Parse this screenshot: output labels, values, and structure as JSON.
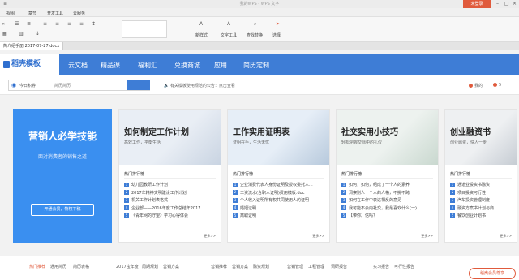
{
  "window": {
    "title": "我的WPS - WPS 文字",
    "login": "未登录"
  },
  "menu": [
    "视图",
    "章节",
    "开发工具",
    "云服务"
  ],
  "ribbon": {
    "font_color": "新样式",
    "text_tools": "文字工具",
    "find_replace": "查找替换",
    "select": "选择"
  },
  "doc_tab": "简介绍手册 2017-07-27.docx",
  "nav": {
    "brand": "稻壳模板",
    "items": [
      "云文档",
      "精品课",
      "福利汇",
      "兑换商城",
      "应用",
      "简历定制"
    ]
  },
  "search": {
    "scope": "今日积券",
    "scope2": "简历简历",
    "placeholder": "简历简历"
  },
  "notice": "有关模板使用规范的公告：点击查看",
  "right_links": [
    "我的",
    "5"
  ],
  "promo": {
    "title": "营销人必学技能",
    "subtitle": "面对消费者的销售之道",
    "button": "开通会员，特权下稿"
  },
  "cards": [
    {
      "title": "如何制定工作计划",
      "subtitle": "高效工作，平衡生活",
      "hot": "热门排行榜",
      "items": [
        "幼儿园教研工作计划",
        "2017年精神文明建设工作计划",
        "机关工作计划表格式",
        "企业部——2016年度工作总结年2017...",
        "《青年网的守望》学习心得体会"
      ],
      "more": "更多>>",
      "colors": [
        "#e9eef5",
        "#c9d4e2"
      ]
    },
    {
      "title": "工作实用证明表",
      "subtitle": "证明在手，生活无忧",
      "hot": "热门排行榜",
      "items": [
        "企业消费代表人身份证明及授权委托人...",
        "工资流水(含职人证明)费用模板.doc",
        "个人收入证明所有权共同使用人的证明",
        "婚姻证明",
        "离职证明"
      ],
      "more": "更多>>",
      "colors": [
        "#e6eef7",
        "#b7c9dc"
      ]
    },
    {
      "title": "社交实用小技巧",
      "subtitle": "轻松把握交际中的礼仪",
      "hot": "热门排行榜",
      "items": [
        "如何，如何，组成了一个人的素养",
        "洞察别人一个人的人格，不挑不跨",
        "如何在工作中表达相反的意见",
        "我可能不会向社交，我最喜欢什么(一)",
        "【带你】信吗？"
      ],
      "more": "更多>>",
      "colors": [
        "#edf2ef",
        "#c9d8cf"
      ]
    },
    {
      "title": "创业融资书",
      "subtitle": "创业融资，快人一步",
      "hot": "热门排行榜",
      "items": [
        "通道业投资书融资",
        "项目投资可行性",
        "汽车投资管理制度",
        "融资方案书计划与商",
        "餐饮创业计划书"
      ],
      "more": "更多>>",
      "colors": [
        "#eef0f2",
        "#c6ccd3"
      ]
    }
  ],
  "footer": {
    "row1": [
      "热门推荐",
      "通用简历",
      "简历表格",
      "2017宝年度",
      "周期规划",
      "营销方案",
      "营销推荐",
      "营销方案",
      "融资规划",
      "营销管理",
      "工程管理",
      "调研报告",
      "实习报告",
      "可行性报告"
    ],
    "member_button": "稻壳会员尊享"
  }
}
